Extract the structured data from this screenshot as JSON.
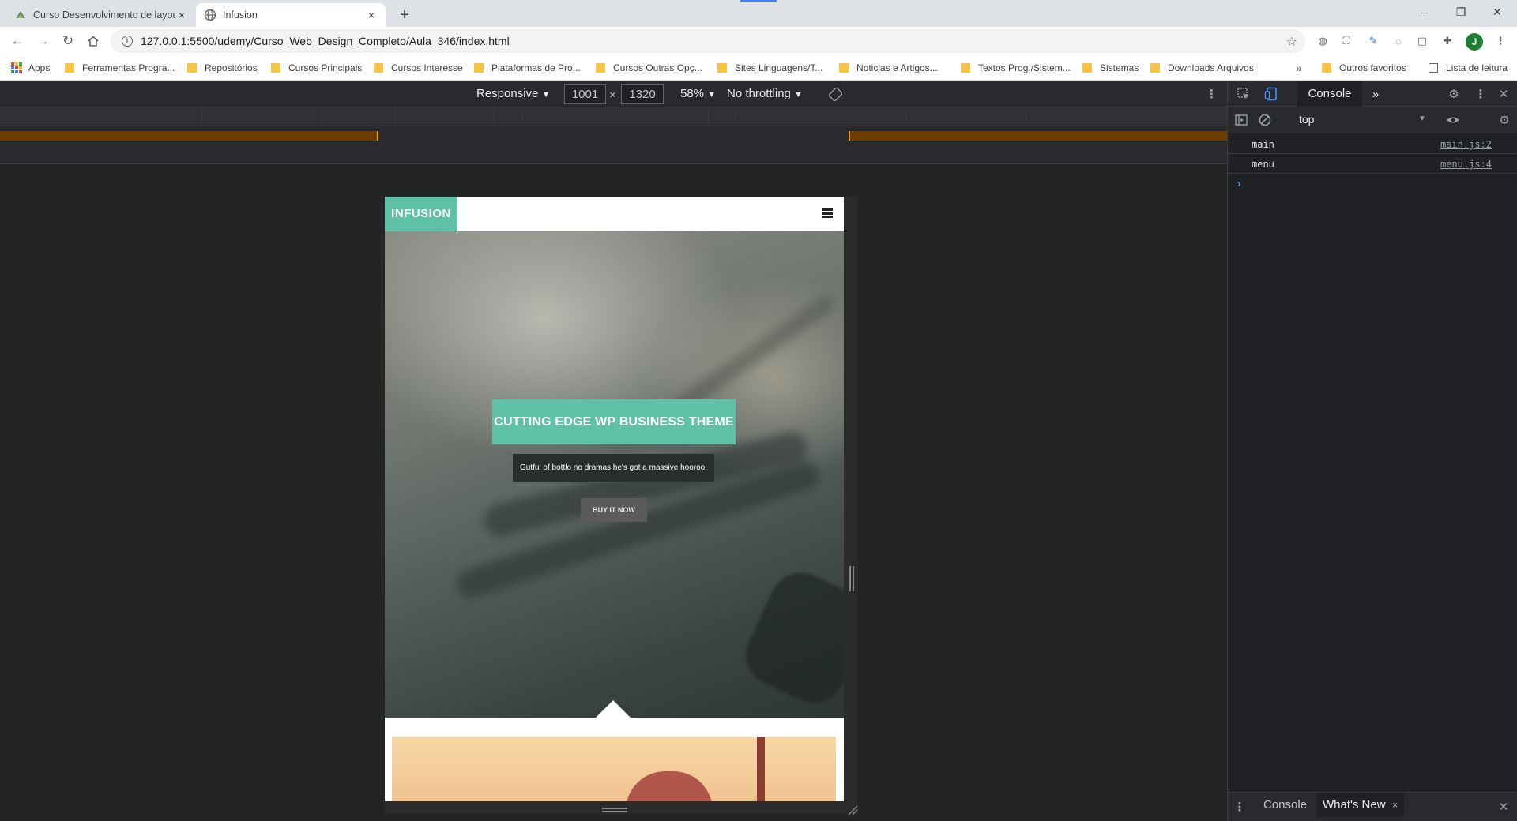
{
  "browser": {
    "tabs": [
      {
        "title": "Curso Desenvolvimento de layou",
        "close": "×"
      },
      {
        "title": "Infusion",
        "close": "×"
      }
    ],
    "new_tab": "+",
    "window": {
      "minimize": "–",
      "restore": "❐",
      "close": "✕"
    },
    "url": "127.0.0.1:5500/udemy/Curso_Web_Design_Completo/Aula_346/index.html",
    "profile_initial": "J"
  },
  "bookmarks": [
    {
      "label": "Apps"
    },
    {
      "label": "Ferramentas Progra..."
    },
    {
      "label": "Repositórios"
    },
    {
      "label": "Cursos Principais"
    },
    {
      "label": "Cursos Interesse"
    },
    {
      "label": "Plataformas de Pro..."
    },
    {
      "label": "Cursos Outras Opç..."
    },
    {
      "label": "Sites Linguagens/T..."
    },
    {
      "label": "Noticias e Artigos..."
    },
    {
      "label": "Textos Prog./Sistem..."
    },
    {
      "label": "Sistemas"
    },
    {
      "label": "Downloads Arquivos"
    }
  ],
  "bookmarks_more": "»",
  "bookmarks_right": [
    {
      "label": "Outros favoritos"
    },
    {
      "label": "Lista de leitura"
    }
  ],
  "device_toolbar": {
    "mode": "Responsive",
    "width": "1001",
    "times": "×",
    "height": "1320",
    "zoom": "58%",
    "throttling": "No throttling"
  },
  "site": {
    "logo": "INFUSION",
    "hero_title": "CUTTING EDGE WP BUSINESS THEME",
    "hero_subtitle": "Gutful of bottlo no dramas he's got a massive hooroo.",
    "cta": "BUY IT NOW"
  },
  "devtools": {
    "active_tab": "Console",
    "more_tabs": "»",
    "context": "top",
    "logs": [
      {
        "message": "main",
        "source": "main.js:2"
      },
      {
        "message": "menu",
        "source": "menu.js:4"
      }
    ],
    "prompt": "›",
    "drawer_tabs": [
      "Console",
      "What's New"
    ],
    "drawer_tab_close": "×",
    "drawer_close": "✕"
  },
  "colors": {
    "accent": "#5fc2a6",
    "devtools_bg": "#202124",
    "media_query_orange": "#6b3d00"
  }
}
